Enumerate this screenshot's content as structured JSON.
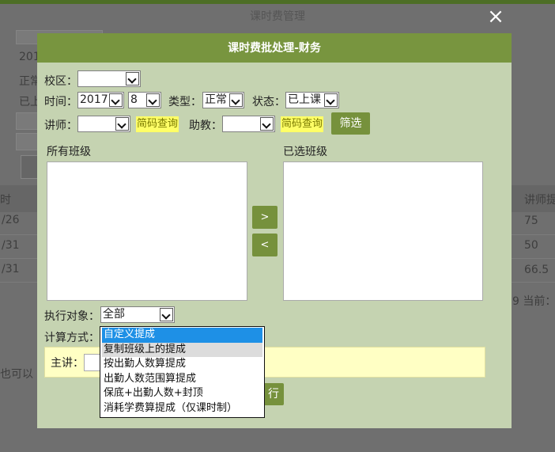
{
  "background": {
    "title": "课时费管理",
    "left_fragments": [
      "201",
      "正常",
      "已上"
    ],
    "row_dates": [
      "/26",
      "/31",
      "/31"
    ],
    "header_left": "时",
    "header_right": "讲师提",
    "right_values": [
      "75",
      "50",
      "66.5"
    ],
    "pager_text": "9 当前：",
    "hint_left": "也可以"
  },
  "close_icon": "×",
  "modal": {
    "title": "课时费批处理-财务",
    "campus_label": "校区：",
    "campus_value": "",
    "time_label": "时间：",
    "year_value": "2017",
    "month_value": "8",
    "type_label": "类型：",
    "type_value": "正常",
    "status_label": "状态：",
    "status_value": "已上课",
    "teacher_label": "讲师：",
    "teacher_value": "",
    "teacher_code_btn": "简码查询",
    "assistant_label": "助教：",
    "assistant_value": "",
    "assistant_code_btn": "简码查询",
    "filter_btn": "筛选",
    "all_classes_label": "所有班级",
    "selected_classes_label": "已选班级",
    "move_right_btn": ">",
    "move_left_btn": "<",
    "target_label": "执行对象：",
    "target_value": "全部",
    "calc_label": "计算方式：",
    "lecturer_label": "主讲：",
    "execute_btn_text": "行"
  },
  "dropdown": {
    "options": [
      "自定义提成",
      "复制班级上的提成",
      "按出勤人数算提成",
      "出勤人数范围算提成",
      "保底+出勤人数+封顶",
      "消耗学费算提成（仅课时制）"
    ],
    "selected_index": 0,
    "hover_index": 1
  },
  "colors": {
    "modal_header": "#78953f",
    "modal_body": "#c5d3b1",
    "button_green": "#76913c",
    "code_btn_bg": "#ffff66",
    "selected_option": "#1e90e6"
  }
}
